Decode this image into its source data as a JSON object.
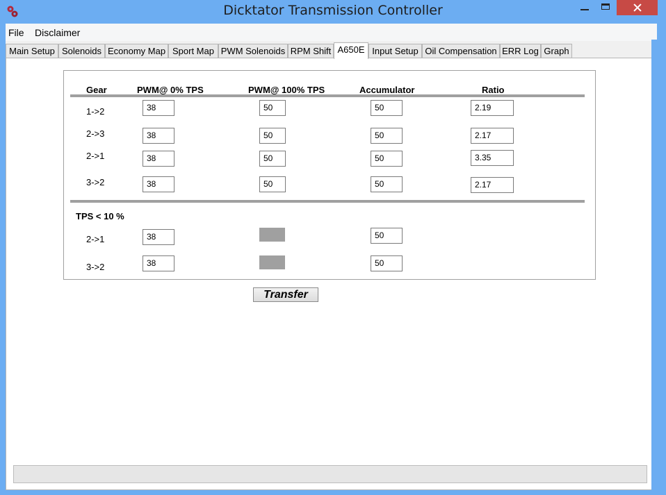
{
  "window": {
    "title": "Dicktator Transmission Controller"
  },
  "menu": [
    "File",
    "Disclaimer"
  ],
  "tabs": [
    "Main Setup",
    "Solenoids",
    "Economy Map",
    "Sport Map",
    "PWM Solenoids",
    "RPM Shift",
    "A650E",
    "Input Setup",
    "Oil Compensation",
    "ERR Log",
    "Graph"
  ],
  "active_tab": "A650E",
  "table": {
    "headers": {
      "gear": "Gear",
      "pwm0": "PWM@ 0% TPS",
      "pwm100": "PWM@ 100% TPS",
      "accumulator": "Accumulator",
      "ratio": "Ratio"
    },
    "rows": [
      {
        "gear": "1->2",
        "pwm0": "38",
        "pwm100": "50",
        "accumulator": "50",
        "ratio": "2.19"
      },
      {
        "gear": "2->3",
        "pwm0": "38",
        "pwm100": "50",
        "accumulator": "50",
        "ratio": "2.17"
      },
      {
        "gear": "2->1",
        "pwm0": "38",
        "pwm100": "50",
        "accumulator": "50",
        "ratio": "3.35"
      },
      {
        "gear": "3->2",
        "pwm0": "38",
        "pwm100": "50",
        "accumulator": "50",
        "ratio": "2.17"
      }
    ],
    "low_tps_label": "TPS < 10 %",
    "low_tps_rows": [
      {
        "gear": "2->1",
        "pwm0": "38",
        "accumulator": "50"
      },
      {
        "gear": "3->2",
        "pwm0": "38",
        "accumulator": "50"
      }
    ]
  },
  "transfer_label": "Transfer",
  "colors": {
    "titlebar": "#6cadf2",
    "close_button": "#c74a45",
    "disabled_field": "#a0a0a0"
  }
}
